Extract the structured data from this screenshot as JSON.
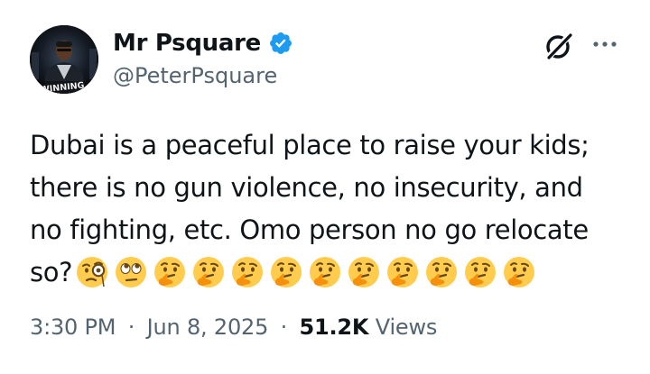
{
  "author": {
    "name": "Mr Psquare",
    "handle": "@PeterPsquare",
    "avatar_caption": "WINNING",
    "verified": true,
    "verified_color": "#1d9bf0"
  },
  "icons": {
    "grok": "grok-icon",
    "more": "more-icon"
  },
  "tweet": {
    "text": "Dubai is a peaceful place to raise your kids;\nthere is no gun violence, no insecurity, and\nno fighting, etc. Omo person no go relocate\nso?",
    "emojis": [
      "face-with-monocle",
      "face-with-rolling-eyes",
      "thinking-face",
      "thinking-face",
      "thinking-face",
      "thinking-face",
      "thinking-face",
      "thinking-face",
      "thinking-face",
      "thinking-face",
      "thinking-face",
      "thinking-face"
    ]
  },
  "meta": {
    "time": "3:30 PM",
    "dot1": "·",
    "date": "Jun 8, 2025",
    "dot2": "·",
    "views_count": "51.2K",
    "views_label": "Views"
  },
  "colors": {
    "text": "#0f1419",
    "secondary": "#536471",
    "emoji_yellow": "#ffcc4d",
    "background": "#ffffff"
  }
}
